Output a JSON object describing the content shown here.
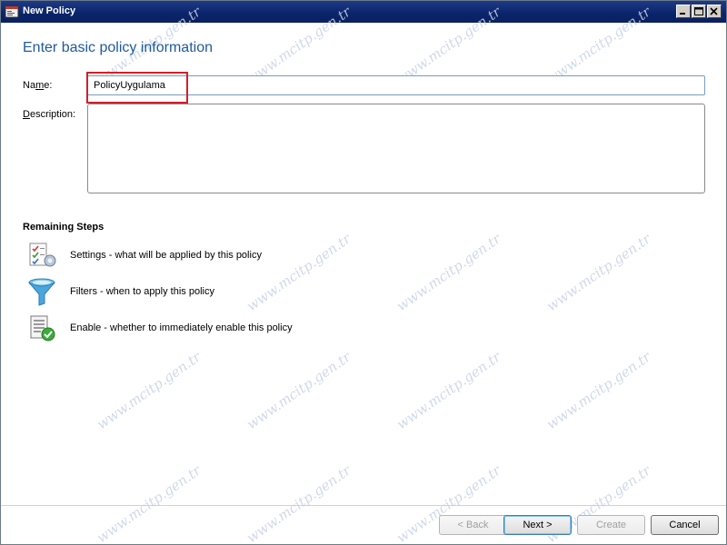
{
  "window": {
    "title": "New Policy"
  },
  "page": {
    "heading": "Enter basic policy information",
    "name_label_prefix": "Na",
    "name_label_accel": "m",
    "name_label_suffix": "e:",
    "name_value": "PolicyUygulama",
    "description_label_accel": "D",
    "description_label_suffix": "escription:",
    "description_value": ""
  },
  "remaining": {
    "title": "Remaining Steps",
    "steps": [
      {
        "icon": "settings-checklist-icon",
        "text": "Settings - what will be applied by this policy"
      },
      {
        "icon": "funnel-filter-icon",
        "text": "Filters - when to apply this policy"
      },
      {
        "icon": "enable-document-check-icon",
        "text": "Enable - whether to immediately enable this policy"
      }
    ]
  },
  "buttons": {
    "back": "< Back",
    "next": "Next >",
    "create": "Create",
    "cancel": "Cancel"
  },
  "watermark": "www.mcitp.gen.tr",
  "colors": {
    "heading": "#1e5aa0",
    "highlight": "#d0202a",
    "titlebar": "#0a246a"
  }
}
